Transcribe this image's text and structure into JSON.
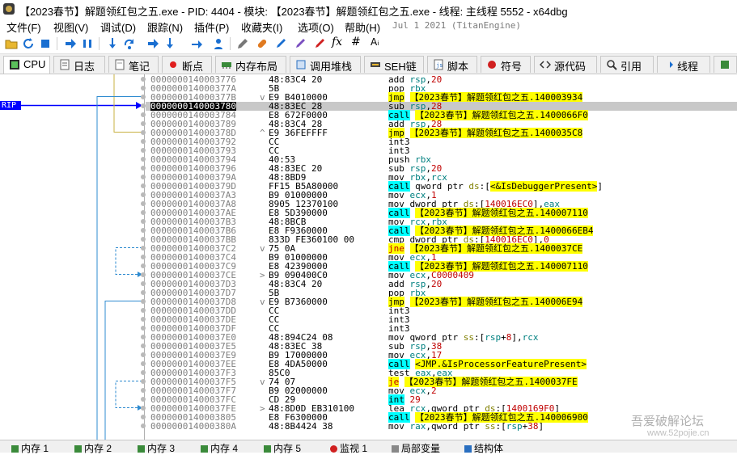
{
  "window": {
    "title": "【2023春节】解题领红包之五.exe - PID: 4404 - 模块: 【2023春节】解题领红包之五.exe - 线程: 主线程 5552 - x64dbg"
  },
  "menu": {
    "items": [
      "文件(F)",
      "视图(V)",
      "调试(D)",
      "跟踪(N)",
      "插件(P)",
      "收藏夹(I)",
      "选项(O)",
      "帮助(H)"
    ],
    "date": "Jul 1 2021 (TitanEngine)"
  },
  "toolbar": {
    "icons": [
      "open-icon",
      "restart-icon",
      "stop-icon",
      "run-icon",
      "pause-icon",
      "step-into-icon",
      "step-over-icon",
      "trace-into-icon",
      "trace-over-icon",
      "execute-till-return-icon",
      "run-to-user-code-icon",
      "highlight-icon",
      "patch-icon",
      "comment-icon",
      "label-icon",
      "bookmark-icon",
      "function-icon",
      "hash-icon",
      "font-icon",
      "calculator-icon"
    ],
    "fx_label": "fx",
    "hash_label": "#",
    "az_label": "Aᵢ"
  },
  "tabs": [
    {
      "label": "CPU",
      "icon": "cpu-icon",
      "active": true
    },
    {
      "label": "日志",
      "icon": "log-icon",
      "active": false
    },
    {
      "label": "笔记",
      "icon": "notes-icon",
      "active": false
    },
    {
      "label": "断点",
      "icon": "breakpoint-icon",
      "active": false
    },
    {
      "label": "内存布局",
      "icon": "memory-map-icon",
      "active": false
    },
    {
      "label": "调用堆栈",
      "icon": "call-stack-icon",
      "active": false
    },
    {
      "label": "SEH链",
      "icon": "seh-icon",
      "active": false
    },
    {
      "label": "脚本",
      "icon": "script-icon",
      "active": false
    },
    {
      "label": "符号",
      "icon": "symbols-icon",
      "active": false
    },
    {
      "label": "源代码",
      "icon": "source-icon",
      "active": false
    },
    {
      "label": "引用",
      "icon": "references-icon",
      "active": false
    },
    {
      "label": "线程",
      "icon": "threads-icon",
      "active": false
    }
  ],
  "rip_label": "RIP",
  "disasm": {
    "rows": [
      {
        "addr": "0000000140003776",
        "mark": "",
        "bytes": "48:83C4 20",
        "instr": [
          [
            "m",
            "add "
          ],
          [
            "reg",
            "rsp"
          ],
          [
            "m",
            ","
          ],
          [
            "num",
            "20"
          ]
        ]
      },
      {
        "addr": "000000014000377A",
        "mark": "",
        "bytes": "5B",
        "instr": [
          [
            "m",
            "pop "
          ],
          [
            "reg",
            "rbx"
          ]
        ]
      },
      {
        "addr": "000000014000377B",
        "mark": "v",
        "bytes": "E9 B4010000",
        "instr": [
          [
            "hl-jmp",
            "jmp"
          ],
          [
            "m",
            " "
          ],
          [
            "apihl",
            "【2023春节】解题领红包之五.140003934"
          ]
        ]
      },
      {
        "addr": "0000000140003780",
        "mark": "",
        "bytes": "48:83EC 28",
        "instr": [
          [
            "m",
            "sub "
          ],
          [
            "reg",
            "rsp"
          ],
          [
            "m",
            ","
          ],
          [
            "num",
            "28"
          ]
        ],
        "sel": true
      },
      {
        "addr": "0000000140003784",
        "mark": "",
        "bytes": "E8 672F0000",
        "instr": [
          [
            "hl-call",
            "call"
          ],
          [
            "m",
            " "
          ],
          [
            "apihl",
            "【2023春节】解题领红包之五.1400066F0"
          ]
        ]
      },
      {
        "addr": "0000000140003789",
        "mark": "",
        "bytes": "48:83C4 28",
        "instr": [
          [
            "m",
            "add "
          ],
          [
            "reg",
            "rsp"
          ],
          [
            "m",
            ","
          ],
          [
            "num",
            "28"
          ]
        ]
      },
      {
        "addr": "000000014000378D",
        "mark": "^",
        "bytes": "E9 36FEFFFF",
        "instr": [
          [
            "hl-jmp",
            "jmp"
          ],
          [
            "m",
            " "
          ],
          [
            "apihl",
            "【2023春节】解题领红包之五.1400035C8"
          ]
        ]
      },
      {
        "addr": "0000000140003792",
        "mark": "",
        "bytes": "CC",
        "instr": [
          [
            "m",
            "int3"
          ]
        ]
      },
      {
        "addr": "0000000140003793",
        "mark": "",
        "bytes": "CC",
        "instr": [
          [
            "m",
            "int3"
          ]
        ]
      },
      {
        "addr": "0000000140003794",
        "mark": "",
        "bytes": "40:53",
        "instr": [
          [
            "m",
            "push "
          ],
          [
            "reg",
            "rbx"
          ]
        ]
      },
      {
        "addr": "0000000140003796",
        "mark": "",
        "bytes": "48:83EC 20",
        "instr": [
          [
            "m",
            "sub "
          ],
          [
            "reg",
            "rsp"
          ],
          [
            "m",
            ","
          ],
          [
            "num",
            "20"
          ]
        ]
      },
      {
        "addr": "000000014000379A",
        "mark": "",
        "bytes": "48:8BD9",
        "instr": [
          [
            "m",
            "mov "
          ],
          [
            "reg",
            "rbx"
          ],
          [
            "m",
            ","
          ],
          [
            "reg",
            "rcx"
          ]
        ]
      },
      {
        "addr": "000000014000379D",
        "mark": "",
        "bytes": "FF15 B5A80000",
        "instr": [
          [
            "hl-call",
            "call"
          ],
          [
            "m",
            " qword ptr "
          ],
          [
            "kw",
            "ds"
          ],
          [
            "m",
            ":["
          ],
          [
            "apihl",
            "<&IsDebuggerPresent>"
          ],
          [
            "m",
            "]"
          ]
        ]
      },
      {
        "addr": "00000001400037A3",
        "mark": "",
        "bytes": "B9 01000000",
        "instr": [
          [
            "m",
            "mov "
          ],
          [
            "reg",
            "ecx"
          ],
          [
            "m",
            ","
          ],
          [
            "num",
            "1"
          ]
        ]
      },
      {
        "addr": "00000001400037A8",
        "mark": "",
        "bytes": "8905 12370100",
        "instr": [
          [
            "m",
            "mov dword ptr "
          ],
          [
            "kw",
            "ds"
          ],
          [
            "m",
            ":["
          ],
          [
            "num",
            "140016EC0"
          ],
          [
            "m",
            "],"
          ],
          [
            "reg",
            "eax"
          ]
        ]
      },
      {
        "addr": "00000001400037AE",
        "mark": "",
        "bytes": "E8 5D390000",
        "instr": [
          [
            "hl-call",
            "call"
          ],
          [
            "m",
            " "
          ],
          [
            "apihl",
            "【2023春节】解题领红包之五.140007110"
          ]
        ]
      },
      {
        "addr": "00000001400037B3",
        "mark": "",
        "bytes": "48:8BCB",
        "instr": [
          [
            "m",
            "mov "
          ],
          [
            "reg",
            "rcx"
          ],
          [
            "m",
            ","
          ],
          [
            "reg",
            "rbx"
          ]
        ]
      },
      {
        "addr": "00000001400037B6",
        "mark": "",
        "bytes": "E8 F9360000",
        "instr": [
          [
            "hl-call",
            "call"
          ],
          [
            "m",
            " "
          ],
          [
            "apihl",
            "【2023春节】解题领红包之五.1400066EB4"
          ]
        ]
      },
      {
        "addr": "00000001400037BB",
        "mark": "",
        "bytes": "833D FE360100 00",
        "instr": [
          [
            "m",
            "cmp dword ptr "
          ],
          [
            "kw",
            "ds"
          ],
          [
            "m",
            ":["
          ],
          [
            "num",
            "140016EC0"
          ],
          [
            "m",
            "],"
          ],
          [
            "num",
            "0"
          ]
        ]
      },
      {
        "addr": "00000001400037C2",
        "mark": "v",
        "bytes": "75 0A",
        "instr": [
          [
            "hl-jcc",
            "jne"
          ],
          [
            "m",
            " "
          ],
          [
            "apihl",
            "【2023春节】解题领红包之五.1400037CE"
          ]
        ]
      },
      {
        "addr": "00000001400037C4",
        "mark": "",
        "bytes": "B9 01000000",
        "instr": [
          [
            "m",
            "mov "
          ],
          [
            "reg",
            "ecx"
          ],
          [
            "m",
            ","
          ],
          [
            "num",
            "1"
          ]
        ]
      },
      {
        "addr": "00000001400037C9",
        "mark": "",
        "bytes": "E8 42390000",
        "instr": [
          [
            "hl-call",
            "call"
          ],
          [
            "m",
            " "
          ],
          [
            "apihl",
            "【2023春节】解题领红包之五.140007110"
          ]
        ]
      },
      {
        "addr": "00000001400037CE",
        "mark": ">",
        "bytes": "B9 090400C0",
        "instr": [
          [
            "m",
            "mov "
          ],
          [
            "reg",
            "ecx"
          ],
          [
            "m",
            ","
          ],
          [
            "num",
            "C0000409"
          ]
        ]
      },
      {
        "addr": "00000001400037D3",
        "mark": "",
        "bytes": "48:83C4 20",
        "instr": [
          [
            "m",
            "add "
          ],
          [
            "reg",
            "rsp"
          ],
          [
            "m",
            ","
          ],
          [
            "num",
            "20"
          ]
        ]
      },
      {
        "addr": "00000001400037D7",
        "mark": "",
        "bytes": "5B",
        "instr": [
          [
            "m",
            "pop "
          ],
          [
            "reg",
            "rbx"
          ]
        ]
      },
      {
        "addr": "00000001400037D8",
        "mark": "v",
        "bytes": "E9 B7360000",
        "instr": [
          [
            "hl-jmp",
            "jmp"
          ],
          [
            "m",
            " "
          ],
          [
            "apihl",
            "【2023春节】解题领红包之五.140006E94"
          ]
        ]
      },
      {
        "addr": "00000001400037DD",
        "mark": "",
        "bytes": "CC",
        "instr": [
          [
            "m",
            "int3"
          ]
        ]
      },
      {
        "addr": "00000001400037DE",
        "mark": "",
        "bytes": "CC",
        "instr": [
          [
            "m",
            "int3"
          ]
        ]
      },
      {
        "addr": "00000001400037DF",
        "mark": "",
        "bytes": "CC",
        "instr": [
          [
            "m",
            "int3"
          ]
        ]
      },
      {
        "addr": "00000001400037E0",
        "mark": "",
        "bytes": "48:894C24 08",
        "instr": [
          [
            "m",
            "mov qword ptr "
          ],
          [
            "kw",
            "ss"
          ],
          [
            "m",
            ":["
          ],
          [
            "reg",
            "rsp"
          ],
          [
            "m",
            "+"
          ],
          [
            "num",
            "8"
          ],
          [
            "m",
            "],"
          ],
          [
            "reg",
            "rcx"
          ]
        ]
      },
      {
        "addr": "00000001400037E5",
        "mark": "",
        "bytes": "48:83EC 38",
        "instr": [
          [
            "m",
            "sub "
          ],
          [
            "reg",
            "rsp"
          ],
          [
            "m",
            ","
          ],
          [
            "num",
            "38"
          ]
        ]
      },
      {
        "addr": "00000001400037E9",
        "mark": "",
        "bytes": "B9 17000000",
        "instr": [
          [
            "m",
            "mov "
          ],
          [
            "reg",
            "ecx"
          ],
          [
            "m",
            ","
          ],
          [
            "num",
            "17"
          ]
        ]
      },
      {
        "addr": "00000001400037EE",
        "mark": "",
        "bytes": "E8 4DA50000",
        "instr": [
          [
            "hl-call",
            "call"
          ],
          [
            "m",
            " "
          ],
          [
            "apihl",
            "<JMP.&IsProcessorFeaturePresent>"
          ]
        ]
      },
      {
        "addr": "00000001400037F3",
        "mark": "",
        "bytes": "85C0",
        "instr": [
          [
            "m",
            "test "
          ],
          [
            "reg",
            "eax"
          ],
          [
            "m",
            ","
          ],
          [
            "reg",
            "eax"
          ]
        ]
      },
      {
        "addr": "00000001400037F5",
        "mark": "v",
        "bytes": "74 07",
        "instr": [
          [
            "hl-jcc",
            "je"
          ],
          [
            "m",
            " "
          ],
          [
            "apihl",
            "【2023春节】解题领红包之五.1400037FE"
          ]
        ]
      },
      {
        "addr": "00000001400037F7",
        "mark": "",
        "bytes": "B9 02000000",
        "instr": [
          [
            "m",
            "mov "
          ],
          [
            "reg",
            "ecx"
          ],
          [
            "m",
            ","
          ],
          [
            "num",
            "2"
          ]
        ]
      },
      {
        "addr": "00000001400037FC",
        "mark": "",
        "bytes": "CD 29",
        "instr": [
          [
            "hl-int",
            "int"
          ],
          [
            "m",
            " "
          ],
          [
            "num",
            "29"
          ]
        ]
      },
      {
        "addr": "00000001400037FE",
        "mark": ">",
        "bytes": "48:8D0D EB310100",
        "instr": [
          [
            "m",
            "lea "
          ],
          [
            "reg",
            "rcx"
          ],
          [
            "m",
            ",qword ptr "
          ],
          [
            "kw",
            "ds"
          ],
          [
            "m",
            ":["
          ],
          [
            "num",
            "1400169F0"
          ],
          [
            "m",
            "]"
          ]
        ]
      },
      {
        "addr": "0000000140003805",
        "mark": "",
        "bytes": "E8 F6300000",
        "instr": [
          [
            "hl-call",
            "call"
          ],
          [
            "m",
            " "
          ],
          [
            "apihl",
            "【2023春节】解题领红包之五.140006900"
          ]
        ]
      },
      {
        "addr": "000000014000380A",
        "mark": "",
        "bytes": "48:8B4424 38",
        "instr": [
          [
            "m",
            "mov "
          ],
          [
            "reg",
            "rax"
          ],
          [
            "m",
            ",qword ptr "
          ],
          [
            "kw",
            "ss"
          ],
          [
            "m",
            ":["
          ],
          [
            "reg",
            "rsp"
          ],
          [
            "m",
            "+"
          ],
          [
            "num",
            "38"
          ],
          [
            "m",
            "]"
          ]
        ]
      }
    ]
  },
  "statusbar": {
    "tabs": [
      "内存 1",
      "内存 2",
      "内存 3",
      "内存 4",
      "内存 5",
      "监视 1",
      "局部变量",
      "结构体"
    ]
  },
  "watermark": {
    "line1": "吾爱破解论坛",
    "line2": "www.52pojie.cn"
  },
  "colors": {
    "rip_bg": "#0000ff",
    "selected_row": "#c8c8c8",
    "call_highlight": "#00ffff",
    "jmp_highlight": "#ffff00"
  }
}
